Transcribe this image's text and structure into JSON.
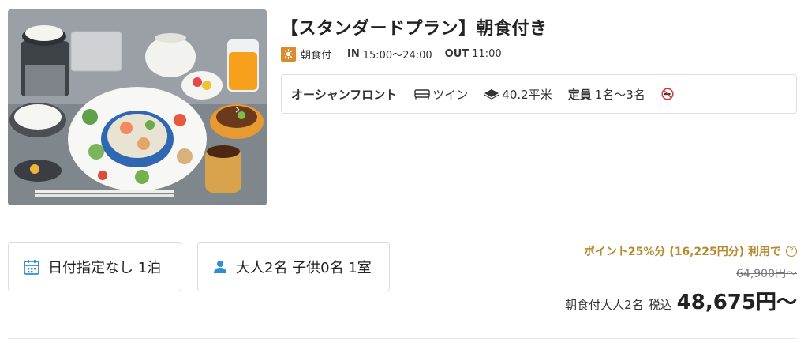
{
  "plan": {
    "title": "【スタンダードプラン】朝食付き",
    "meal_label": "朝食付",
    "meal_icon": "sun-icon",
    "checkin_label": "IN",
    "checkin_time": "15:00〜24:00",
    "checkout_label": "OUT",
    "checkout_time": "11:00"
  },
  "room": {
    "view": "オーシャンフロント",
    "bed_icon": "bed-icon",
    "bed": "ツイン",
    "area_icon": "floor-area-icon",
    "area": "40.2平米",
    "capacity_label": "定員",
    "capacity": "1名〜3名",
    "smoking_icon": "no-smoking-icon"
  },
  "search": {
    "date_icon": "calendar-icon",
    "date": "日付指定なし 1泊",
    "guests_icon": "person-icon",
    "guests": "大人2名 子供0名 1室"
  },
  "price": {
    "points": "ポイント25%分 (16,225円分) 利用で",
    "help_icon": "question-circle-icon",
    "help_glyph": "?",
    "original": "64,900円〜",
    "condition": "朝食付大人2名",
    "tax": "税込",
    "final": "48,675円〜"
  },
  "colors": {
    "accent_gold": "#b48a2c",
    "meal_badge": "#d98c2b",
    "icon_blue": "#2a8fd6"
  }
}
